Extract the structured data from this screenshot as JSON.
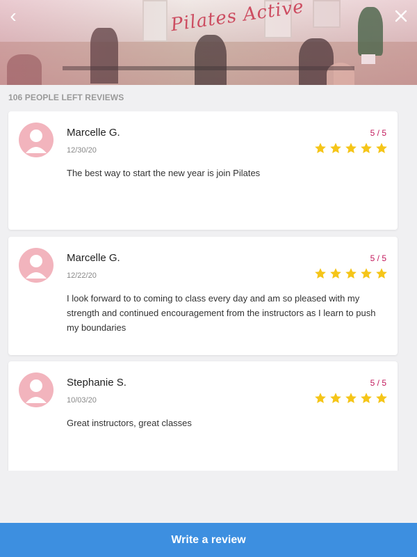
{
  "header": {
    "back_label": "‹",
    "logo_text": "Pilates Active"
  },
  "reviews_count_label": "106 PEOPLE LEFT REVIEWS",
  "colors": {
    "accent": "#3d8fe0",
    "star": "#f5c518",
    "score": "#c2185b",
    "avatar": "#f2b4bd"
  },
  "reviews": [
    {
      "name": "Marcelle G.",
      "date": "12/30/20",
      "score": "5 / 5",
      "stars": 5,
      "text": "The best way to start the new year is join Pilates"
    },
    {
      "name": "Marcelle G.",
      "date": "12/22/20",
      "score": "5 / 5",
      "stars": 5,
      "text": "I look forward to to coming to class every day and am so pleased with my strength and continued encouragement from the instructors as I learn to push my boundaries"
    },
    {
      "name": "Stephanie S.",
      "date": "10/03/20",
      "score": "5 / 5",
      "stars": 5,
      "text": "Great instructors, great classes"
    }
  ],
  "write_review_label": "Write a review"
}
